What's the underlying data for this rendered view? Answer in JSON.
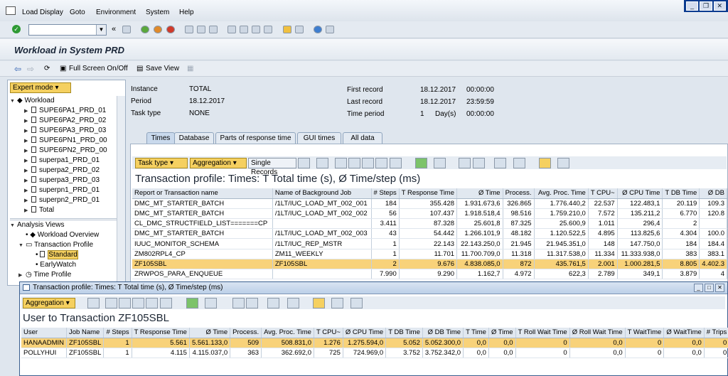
{
  "menubar": {
    "items": [
      "Load Display",
      "Goto",
      "Environment",
      "System",
      "Help"
    ]
  },
  "titlebar": {
    "title": "Workload in System PRD"
  },
  "apptoolbar": {
    "full_screen": "Full Screen On/Off",
    "save_view": "Save View"
  },
  "left": {
    "expert_mode": "Expert mode",
    "workload_label": "Workload",
    "workload_items": [
      "SUPE6PA1_PRD_01",
      "SUPE6PA2_PRD_02",
      "SUPE6PA3_PRD_03",
      "SUPE6PN1_PRD_00",
      "SUPE6PN2_PRD_00",
      "superpa1_PRD_01",
      "superpa2_PRD_02",
      "superpa3_PRD_03",
      "superpn1_PRD_01",
      "superpn2_PRD_01",
      "Total"
    ],
    "analysis_label": "Analysis Views",
    "analysis_items": [
      "Workload Overview",
      "Transaction Profile",
      "Standard",
      "EarlyWatch",
      "Time Profile"
    ]
  },
  "info": {
    "instance_label": "Instance",
    "instance_value": "TOTAL",
    "period_label": "Period",
    "period_value": "18.12.2017",
    "tasktype_label": "Task type",
    "tasktype_value": "NONE",
    "first_label": "First record",
    "first_date": "18.12.2017",
    "first_time": "00:00:00",
    "last_label": "Last record",
    "last_date": "18.12.2017",
    "last_time": "23:59:59",
    "tp_label": "Time period",
    "tp_value": "1",
    "tp_unit": "Day(s)",
    "tp_time": "00:00:00"
  },
  "tabs": [
    "Times",
    "Database",
    "Parts of response time",
    "GUI times",
    "All data"
  ],
  "main": {
    "buttons": {
      "task_type": "Task type",
      "aggregation": "Aggregation",
      "single_records": "Single Records"
    },
    "title": "Transaction profile: Times: T Total time (s), Ø Time/step (ms)",
    "headers": [
      "Report or Transaction name",
      "Name of Background Job",
      "# Steps",
      "T Response Time",
      "Ø Time",
      "Process.",
      "Avg. Proc. Time",
      "T CPU~",
      "Ø CPU Time",
      "T DB Time",
      "Ø DB"
    ],
    "rows": [
      [
        "DMC_MT_STARTER_BATCH",
        "/1LT/IUC_LOAD_MT_002_001",
        "184",
        "355.428",
        "1.931.673,6",
        "326.865",
        "1.776.440,2",
        "22.537",
        "122.483,1",
        "20.119",
        "109.3"
      ],
      [
        "DMC_MT_STARTER_BATCH",
        "/1LT/IUC_LOAD_MT_002_002",
        "56",
        "107.437",
        "1.918.518,4",
        "98.516",
        "1.759.210,0",
        "7.572",
        "135.211,2",
        "6.770",
        "120.8"
      ],
      [
        "CL_DMC_STRUCTFIELD_LIST=======CP",
        "",
        "3.411",
        "87.328",
        "25.601,8",
        "87.325",
        "25.600,9",
        "1.011",
        "296,4",
        "2",
        ""
      ],
      [
        "DMC_MT_STARTER_BATCH",
        "/1LT/IUC_LOAD_MT_002_003",
        "43",
        "54.442",
        "1.266.101,9",
        "48.182",
        "1.120.522,5",
        "4.895",
        "113.825,6",
        "4.304",
        "100.0"
      ],
      [
        "IUUC_MONITOR_SCHEMA",
        "/1LT/IUC_REP_MSTR",
        "1",
        "22.143",
        "22.143.250,0",
        "21.945",
        "21.945.351,0",
        "148",
        "147.750,0",
        "184",
        "184.4"
      ],
      [
        "ZM802RPL4_CP",
        "ZM11_WEEKLY",
        "1",
        "11.701",
        "11.700.709,0",
        "11.318",
        "11.317.538,0",
        "11.334",
        "11.333.938,0",
        "383",
        "383.1"
      ],
      [
        "ZF105SBL",
        "ZF105SBL",
        "2",
        "9.676",
        "4.838.085,0",
        "872",
        "435.761,5",
        "2.001",
        "1.000.281,5",
        "8.805",
        "4.402.3"
      ],
      [
        "ZRWPOS_PARA_ENQUEUE",
        "",
        "7.990",
        "9.290",
        "1.162,7",
        "4.972",
        "622,3",
        "2.789",
        "349,1",
        "3.879",
        "4"
      ]
    ]
  },
  "popup": {
    "window_title": "Transaction profile: Times: T Total time (s), Ø Time/step (ms)",
    "aggregation": "Aggregation",
    "title": "User to Transaction ZF105SBL",
    "headers": [
      "User",
      "Job Name",
      "# Steps",
      "T Response Time",
      "Ø Time",
      "Process.",
      "Avg. Proc. Time",
      "T CPU~",
      "Ø CPU Time",
      "T DB Time",
      "Ø DB Time",
      "T Time",
      "Ø Time",
      "T Roll Wait Time",
      "Ø Roll Wait Time",
      "T WaitTime",
      "Ø WaitTime",
      "# Trips",
      "Ø Ti"
    ],
    "rows": [
      [
        "HANAADMIN",
        "ZF105SBL",
        "1",
        "5.561",
        "5.561.133,0",
        "509",
        "508.831,0",
        "1.276",
        "1.275.594,0",
        "5.052",
        "5.052.300,0",
        "0,0",
        "0,0",
        "0",
        "0,0",
        "0",
        "0,0",
        "0",
        "0"
      ],
      [
        "POLLYHUI",
        "ZF105SBL",
        "1",
        "4.115",
        "4.115.037,0",
        "363",
        "362.692,0",
        "725",
        "724.969,0",
        "3.752",
        "3.752.342,0",
        "0,0",
        "0,0",
        "0",
        "0,0",
        "0",
        "0,0",
        "0",
        "0"
      ]
    ]
  }
}
